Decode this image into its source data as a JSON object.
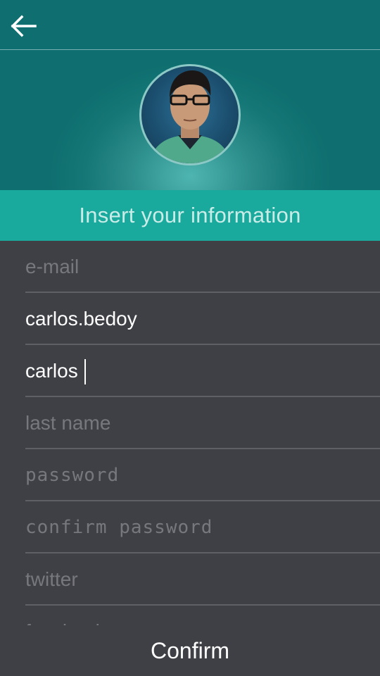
{
  "header": {
    "back_icon": "arrow-left-icon",
    "avatar_icon": "profile-photo"
  },
  "banner": {
    "title": "Insert your information"
  },
  "form": {
    "email": {
      "value": "",
      "placeholder": "e-mail"
    },
    "username": {
      "value": "carlos.bedoy",
      "placeholder": ""
    },
    "first_name": {
      "value": "carlos",
      "placeholder": ""
    },
    "last_name": {
      "value": "",
      "placeholder": "last name"
    },
    "password": {
      "value": "",
      "placeholder": "password"
    },
    "confirm_password": {
      "value": "",
      "placeholder": "confirm password"
    },
    "twitter": {
      "value": "",
      "placeholder": "twitter"
    },
    "facebook": {
      "value": "",
      "placeholder": "facebook"
    }
  },
  "footer": {
    "confirm_label": "Confirm"
  },
  "colors": {
    "header_teal": "#157776",
    "banner_teal": "#1aaa9d",
    "form_background": "#3f4046",
    "placeholder_gray": "#77787d",
    "divider_gray": "#5f6066"
  }
}
